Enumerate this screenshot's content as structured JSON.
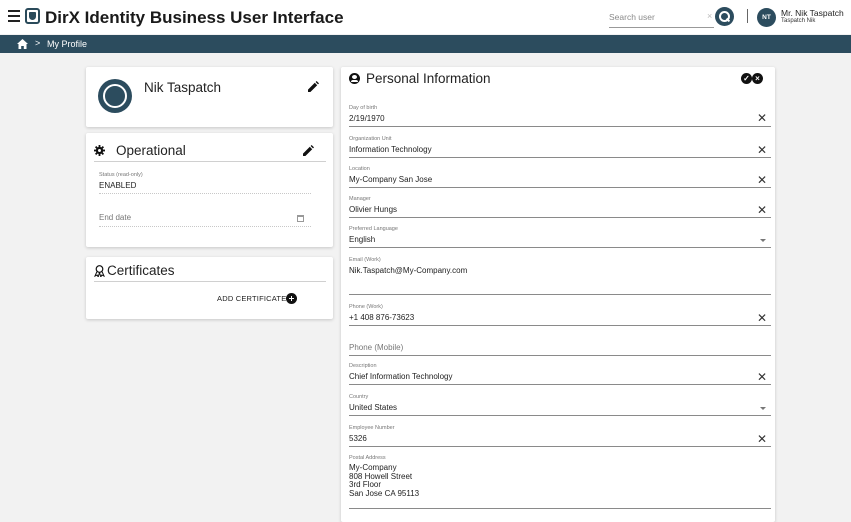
{
  "app": {
    "title": "DirX Identity Business User Interface"
  },
  "search": {
    "placeholder": "Search user",
    "clear_glyph": "×"
  },
  "user": {
    "initials": "NT",
    "display_name": "Mr. Nik Taspatch",
    "sub_name": "Taspatch Nik"
  },
  "breadcrumb": {
    "separator": ">",
    "current": "My Profile"
  },
  "profile": {
    "name": "Nik Taspatch"
  },
  "operational": {
    "title": "Operational",
    "status_label": "Status (read-only)",
    "status_value": "ENABLED",
    "end_date_placeholder": "End date"
  },
  "certificates": {
    "title": "Certificates",
    "add_label": "ADD CERTIFICATE"
  },
  "personal": {
    "title": "Personal Information",
    "fields": {
      "dob": {
        "label": "Day of birth",
        "value": "2/19/1970"
      },
      "org_unit": {
        "label": "Organization Unit",
        "value": "Information Technology"
      },
      "location": {
        "label": "Location",
        "value": "My-Company San Jose"
      },
      "manager": {
        "label": "Manager",
        "value": "Olivier Hungs"
      },
      "language": {
        "label": "Preferred Language",
        "value": "English"
      },
      "email": {
        "label": "Email (Work)",
        "value": "Nik.Taspatch@My-Company.com"
      },
      "phone_work": {
        "label": "Phone (Work)",
        "value": "+1 408 876-73623"
      },
      "phone_mobile": {
        "placeholder": "Phone (Mobile)"
      },
      "description": {
        "label": "Description",
        "value": "Chief Information Technology"
      },
      "country": {
        "label": "Country",
        "value": "United States"
      },
      "employee_number": {
        "label": "Employee Number",
        "value": "5326"
      },
      "postal_address": {
        "label": "Postal Address",
        "lines": [
          "My-Company",
          "808 Howell Street",
          "3rd Floor",
          "San Jose CA 95113"
        ]
      }
    }
  },
  "icons": {
    "menu": "hamburger-menu-icon",
    "logo": "dirx-shield-logo",
    "search": "magnifier-icon",
    "home": "home-icon",
    "edit": "pencil-icon",
    "settings": "gear-icon",
    "certificate": "award-ribbon-icon",
    "add": "plus-circle-icon",
    "accept": "check-circle-icon",
    "cancel": "x-circle-icon",
    "person": "person-circle-icon",
    "calendar": "calendar-icon"
  },
  "colors": {
    "brand": "#2c4c5e",
    "background": "#f2f2f2"
  }
}
